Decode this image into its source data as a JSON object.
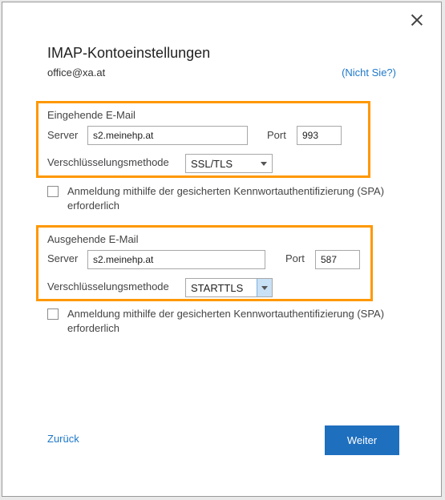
{
  "dialog": {
    "title": "IMAP-Kontoeinstellungen",
    "account_email": "office@xa.at",
    "not_you_link": "(Nicht Sie?)"
  },
  "incoming": {
    "heading": "Eingehende E-Mail",
    "server_label": "Server",
    "server_value": "s2.meinehp.at",
    "port_label": "Port",
    "port_value": "993",
    "encryption_label": "Verschlüsselungsmethode",
    "encryption_value": "SSL/TLS",
    "spa_checkbox_label": "Anmeldung mithilfe der gesicherten Kennwortauthentifizierung (SPA) erforderlich",
    "spa_checked": false
  },
  "outgoing": {
    "heading": "Ausgehende E-Mail",
    "server_label": "Server",
    "server_value": "s2.meinehp.at",
    "port_label": "Port",
    "port_value": "587",
    "encryption_label": "Verschlüsselungsmethode",
    "encryption_value": "STARTTLS",
    "spa_checkbox_label": "Anmeldung mithilfe der gesicherten Kennwortauthentifizierung (SPA) erforderlich",
    "spa_checked": false
  },
  "footer": {
    "back_label": "Zurück",
    "next_label": "Weiter"
  },
  "colors": {
    "highlight": "#ff9800",
    "link": "#1e78c8",
    "primary_button": "#1f6fbf"
  },
  "icons": {
    "close": "close-icon",
    "dropdown": "chevron-down-icon"
  }
}
